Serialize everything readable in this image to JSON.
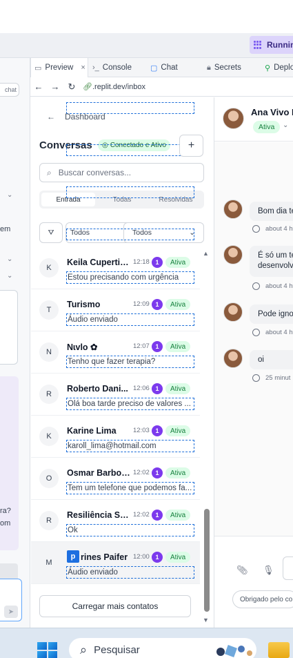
{
  "toolbar": {
    "run_label": "Runnin"
  },
  "workspace_tabs": [
    {
      "label": "Preview",
      "icon": "monitor-icon",
      "closable": true,
      "active": true
    },
    {
      "label": "Console",
      "icon": "terminal-icon"
    },
    {
      "label": "Chat",
      "icon": "chat-bubble-icon"
    },
    {
      "label": "Secrets",
      "icon": "lock-icon"
    },
    {
      "label": "Deplo",
      "icon": "rocket-icon"
    }
  ],
  "browser": {
    "url_prefix": ".replit.dev/",
    "url_path": "inbox"
  },
  "left_strip": {
    "chat_chip": "chat",
    "text_em": "em",
    "text_ra": "ra?",
    "text_om": "om"
  },
  "inbox": {
    "back_label": "Dashboard",
    "title": "Conversas",
    "connection_status": "Conectado e Ativo",
    "new_button": "+",
    "search_placeholder": "Buscar conversas...",
    "tabs": [
      "Entrada",
      "Todas",
      "Resolvidas"
    ],
    "filter_1": "Todos",
    "filter_2": "Todos",
    "conversations": [
      {
        "initial": "K",
        "name": "Keila Cupertino",
        "time": "12:18",
        "unread": "1",
        "status": "Ativa",
        "preview": "Estou precisando com urgência"
      },
      {
        "initial": "T",
        "name": "Turismo",
        "time": "12:09",
        "unread": "1",
        "status": "Ativa",
        "preview": "Áudio enviado"
      },
      {
        "initial": "N",
        "name": "Nɩvlᴏ ✿",
        "time": "12:07",
        "unread": "1",
        "status": "Ativa",
        "preview": "Tenho que fazer terapia?"
      },
      {
        "initial": "R",
        "name": "Roberto Dani...",
        "time": "12:06",
        "unread": "1",
        "status": "Ativa",
        "preview": "Olá boa tarde preciso de valores ..."
      },
      {
        "initial": "K",
        "name": "Karine Lima",
        "time": "12:03",
        "unread": "1",
        "status": "Ativa",
        "preview": "karoll_lima@hotmail.com"
      },
      {
        "initial": "O",
        "name": "Osmar Barbosa",
        "time": "12:02",
        "unread": "1",
        "status": "Ativa",
        "preview": "Tem um telefone que podemos fa..."
      },
      {
        "initial": "R",
        "name": "Resiliência Se...",
        "time": "12:02",
        "unread": "1",
        "status": "Ativa",
        "preview": "Ok"
      },
      {
        "initial": "M",
        "name": "rines Paifer",
        "chip": "p",
        "time": "12:00",
        "unread": "1",
        "status": "Ativa",
        "preview": "Áudio enviado"
      }
    ],
    "load_more": "Carregar mais contatos"
  },
  "chat": {
    "contact_name": "Ana Vivo N",
    "contact_status": "Ativa",
    "messages": [
      {
        "text": "Bom dia te",
        "time": "about 4 h"
      },
      {
        "text": "É só um te",
        "text2": "desenvolv",
        "time": "about 4 h"
      },
      {
        "text": "Pode ignor",
        "time": "about 4 h"
      },
      {
        "text": "oi",
        "time": "25 minut"
      }
    ],
    "quick_reply": "Obrigado pelo co"
  },
  "taskbar": {
    "search_label": "Pesquisar"
  }
}
